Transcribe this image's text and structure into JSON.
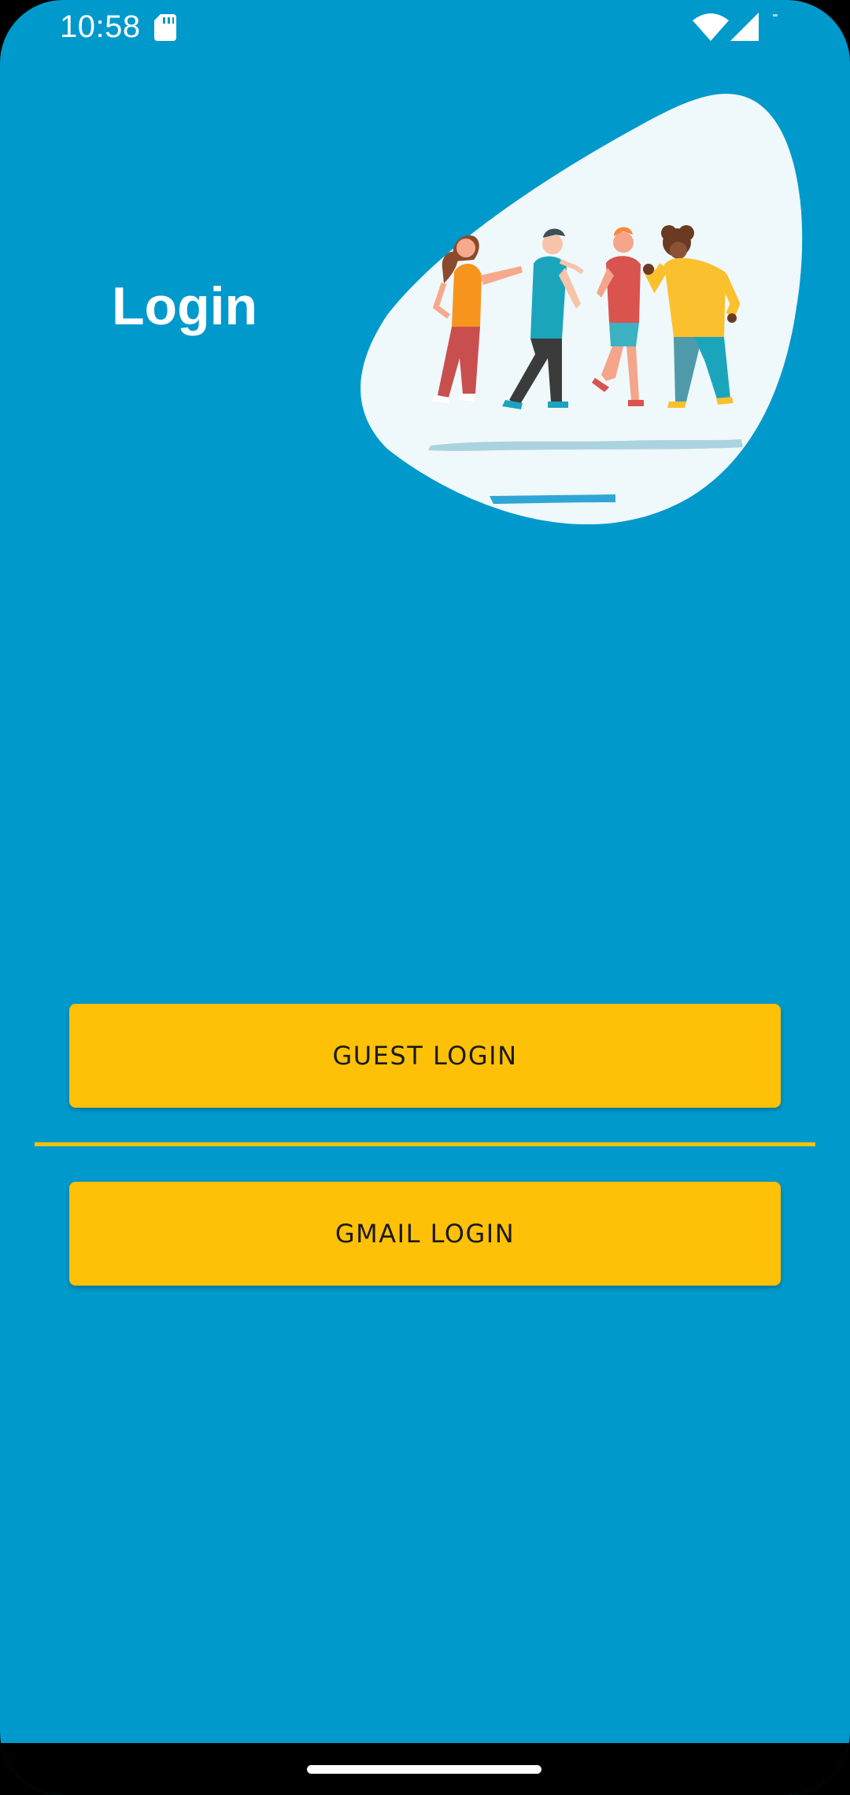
{
  "status_bar": {
    "time": "10:58",
    "icons": [
      "sd-card-icon",
      "wifi-icon",
      "cellular-signal-icon"
    ]
  },
  "header": {
    "title": "Login",
    "illustration": "group-of-friends-illustration"
  },
  "actions": {
    "guest_login_label": "GUEST LOGIN",
    "gmail_login_label": "GMAIL LOGIN"
  },
  "colors": {
    "background": "#0099CC",
    "button": "#FFC107",
    "blob": "#EFF8FA"
  }
}
